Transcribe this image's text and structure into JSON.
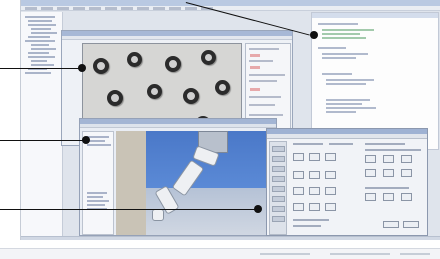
{
  "screenshot": {
    "windows": {
      "explorer": {
        "name": "left-tree-pane"
      },
      "vision": {
        "name": "vision-window",
        "content": "camera-image-washers"
      },
      "simulation": {
        "name": "robot-simulation-window",
        "content": "3d-robot-arm"
      },
      "teach": {
        "name": "teach-pendant-window",
        "content": "jog-button-grid"
      },
      "editor": {
        "name": "program-editor-pane"
      }
    },
    "icons": [
      "callout-dot",
      "callout-dot",
      "callout-dot",
      "callout-dot"
    ]
  },
  "colors": {
    "sky": "#4a78c8",
    "floor": "#d0d7e2",
    "callout": "#111111",
    "washer": "#2b2b2b",
    "titlebar": "#a7b8d6"
  }
}
